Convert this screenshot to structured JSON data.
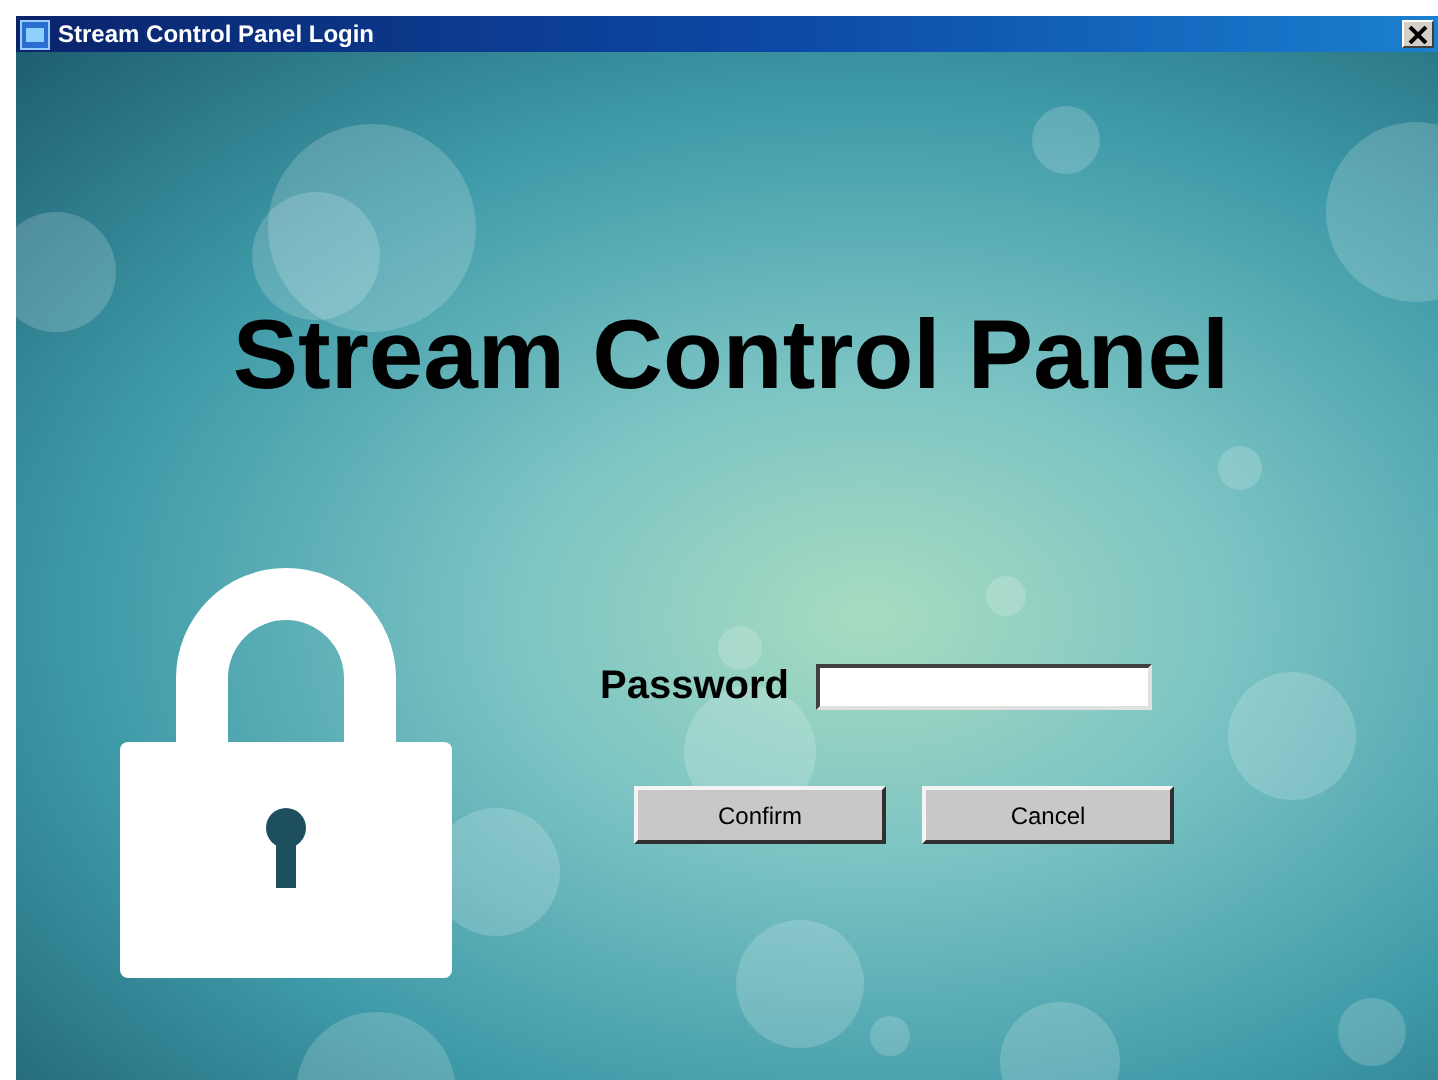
{
  "window": {
    "title": "Stream Control Panel Login"
  },
  "heading": "Stream Control Panel",
  "password": {
    "label": "Password"
  },
  "buttons": [
    {
      "label": "Confirm"
    },
    {
      "label": "Cancel"
    }
  ]
}
